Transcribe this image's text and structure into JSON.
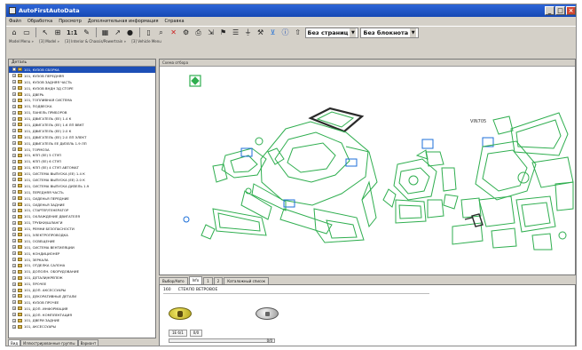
{
  "window": {
    "title": "AutoFirstAutoData",
    "buttons": [
      "_",
      "□",
      "×"
    ]
  },
  "menu": [
    "Файл",
    "Обработка",
    "Просмотр",
    "Дополнительная информация",
    "Справка"
  ],
  "toolbar": {
    "zoom_label": "1:1",
    "page_combo": "Без страниц",
    "note_combo": "Без блокнота"
  },
  "breadcrumbs": [
    "Model Menu »",
    "[3] Model »",
    "[3] Interior & Chassis/Powertrain »",
    "[3] Vehicle Menu"
  ],
  "left_panel": {
    "header": "Деталь",
    "items": [
      "101, КУЗОВ СБОРКА",
      "101, КУЗОВ ПЕРЕДНЯЯ",
      "101, КУЗОВ ЗАДНЯЯ ЧАСТЬ",
      "101, КУЗОВ ВНДН ЗД СТОРЕ",
      "101, ДВЕРЬ",
      "101, ТОПЛИВНАЯ СИСТЕМА",
      "101, ПОДВЕСКА",
      "101, ПАНЕЛЬ ПРИБОРОВ",
      "101, ДВИГАТЕЛЬ (ЕЕ) 1.4 К",
      "101, ДВИГАТЕЛЬ (ЕЕ) 1.6 ЛП ВВКТ",
      "101, ДВИГАТЕЛЬ (ЕЕ) 2.0 К",
      "101, ДВИГАТЕЛЬ (ЕЕ) 2.0 ЛП ЭЛЕКТ",
      "101, ДВИГАТЕЛЬ ЕЕ ДИЗЕЛЬ 1.9 ЛП",
      "101, ТОРМОЗА",
      "101, КПП (ЕЕ) 5 СТУП",
      "101, КПП (ЕЕ) 6 СТУП",
      "101, КПП (ЕЕ) 4 СТУП АВТОМАТ",
      "101, СИСТЕМА ВЫПУСКА (ЕЕ) 1.4 К",
      "101, СИСТЕМА ВЫПУСКА (ЕЕ) 2.0 К",
      "101, СИСТЕМА ВЫПУСКА ДИЗЕЛЬ 1.9",
      "101, ПЕРЕДНЯЯ ЧАСТЬ",
      "101, СИДЕНЬЯ ПЕРЕДНИЕ",
      "101, СИДЕНЬЯ ЗАДНИЕ",
      "101, СТАРТЕР/ГЕНЕРАТОР",
      "101, ОХЛАЖДЕНИЕ ДВИГАТЕЛЯ",
      "101, ТРУБКИ/ШЛАНГИ",
      "101, РЕМНИ БЕЗОПАСНОСТИ",
      "101, ЭЛЕКТРОПРОВОДКА",
      "101, ОСВЕЩЕНИЕ",
      "101, СИСТЕМА ВЕНТИЛЯЦИИ",
      "101, КОНДИЦИОНЕР",
      "101, ЗЕРКАЛА",
      "101, ОТДЕЛКА САЛОНА",
      "101, ДОПОЛН. ОБОРУДОВАНИЕ",
      "101, ДЕТАЛИ/КРЕПЕЖ",
      "101, ПРОЧЕЕ",
      "101, ДОП. АКСЕССУАРЫ",
      "101, ДЕКОРАТИВНЫЕ ДЕТАЛИ",
      "101, КУЗОВ ПРОЧЕЕ",
      "101, ДОП. ИНФОРМАЦИЯ",
      "101, ДОП. КОМПЛЕКТАЦИЯ",
      "101, ДВЕРИ ЗАДНИЕ",
      "101, АКСЕССУАРЫ"
    ]
  },
  "left_tabs": [
    "Вид",
    "Иллюстрированные группы",
    "Вариант"
  ],
  "diagram": {
    "header": "Схема отбора",
    "colors": {
      "line": "#2fae4f",
      "highlight": "#2a2a2a",
      "callout": "#1d6fd8"
    }
  },
  "tabs": [
    "Выбор/Авто",
    "Info",
    "1",
    "2",
    "Каталожный список"
  ],
  "bottom": {
    "code": "160",
    "description": "СТЕКЛО ВЕТРОВОЕ",
    "field1": "1E 6/1",
    "field2": "0/0",
    "position": "0/0"
  }
}
